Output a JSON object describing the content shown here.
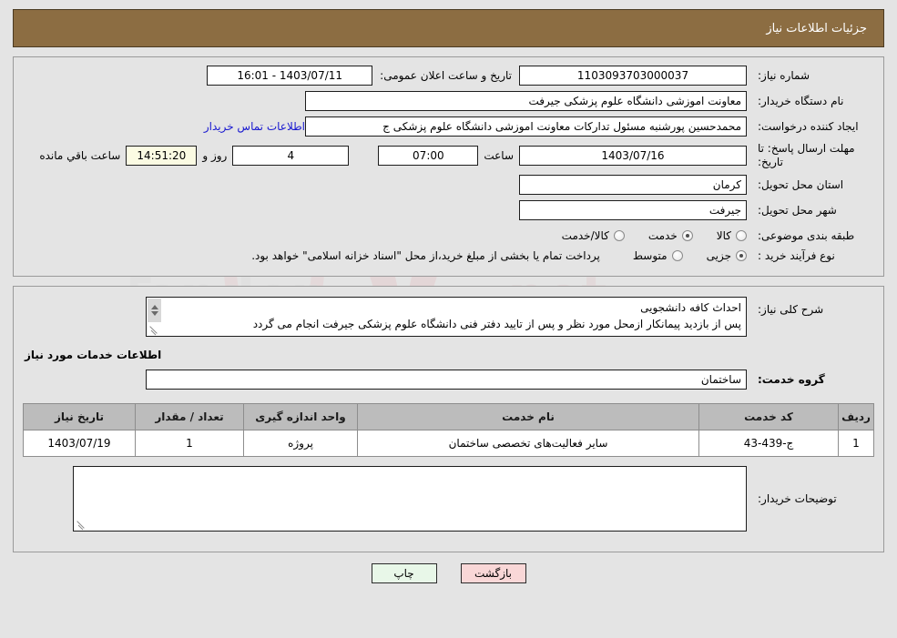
{
  "header": {
    "title": "جزئیات اطلاعات نیاز"
  },
  "form": {
    "need_number_label": "شماره نیاز:",
    "need_number_value": "1103093703000037",
    "public_announce_label": "تاریخ و ساعت اعلان عمومی:",
    "public_announce_value": "16:01 - 1403/07/11",
    "buyer_org_label": "نام دستگاه خریدار:",
    "buyer_org_value": "معاونت اموزشی دانشگاه علوم پزشکی جیرفت",
    "creator_label": "ایجاد کننده درخواست:",
    "creator_value": "محمدحسین پورشنبه مسئول تدارکات معاونت اموزشی دانشگاه علوم پزشکی ج",
    "contact_link": "اطلاعات تماس خریدار",
    "deadline_label": "مهلت ارسال پاسخ: تا تاریخ:",
    "deadline_date": "1403/07/16",
    "hour_label": "ساعت",
    "deadline_hour": "07:00",
    "days_remaining": "4",
    "days_label": "روز و",
    "timer_value": "14:51:20",
    "remaining_label": "ساعت باقي مانده",
    "province_label": "استان محل تحویل:",
    "province_value": "کرمان",
    "city_label": "شهر محل تحویل:",
    "city_value": "جیرفت",
    "category_label": "طبقه بندی موضوعی:",
    "category_options": [
      {
        "label": "کالا",
        "selected": false
      },
      {
        "label": "خدمت",
        "selected": true
      },
      {
        "label": "کالا/خدمت",
        "selected": false
      }
    ],
    "process_label": "نوع فرآیند خرید :",
    "process_options": [
      {
        "label": "جزیی",
        "selected": true
      },
      {
        "label": "متوسط",
        "selected": false
      }
    ],
    "process_note": "پرداخت تمام یا بخشی از مبلغ خرید،از محل \"اسناد خزانه اسلامی\" خواهد بود."
  },
  "description": {
    "label": "شرح کلی نیاز:",
    "text": "احداث کافه دانشجویی\nپس از بازدید پیمانکار ازمحل مورد نظر و پس از تایید دفتر فنی دانشگاه علوم پزشکی جیرفت انجام می گردد"
  },
  "services": {
    "section_title": "اطلاعات خدمات مورد نیاز",
    "group_label": "گروه خدمت:",
    "group_value": "ساختمان",
    "columns": [
      "ردیف",
      "کد خدمت",
      "نام خدمت",
      "واحد اندازه گیری",
      "تعداد / مقدار",
      "تاریخ نیاز"
    ],
    "rows": [
      {
        "index": "1",
        "code": "ج-439-43",
        "name": "سایر فعالیت‌های تخصصی ساختمان",
        "unit": "پروژه",
        "qty": "1",
        "date": "1403/07/19"
      }
    ]
  },
  "buyer_notes": {
    "label": "توضیحات خریدار:",
    "value": ""
  },
  "footer": {
    "print_label": "چاپ",
    "back_label": "بازگشت"
  },
  "colors": {
    "header_brown": "#8c6d42",
    "link_blue": "#1818d0",
    "timer_yellow": "#fbfbe3",
    "print_green": "#e8f7e8",
    "back_pink": "#f9d7d7",
    "table_header_gray": "#bcbcbc"
  },
  "watermark": {
    "text": "AriaTender.net"
  }
}
